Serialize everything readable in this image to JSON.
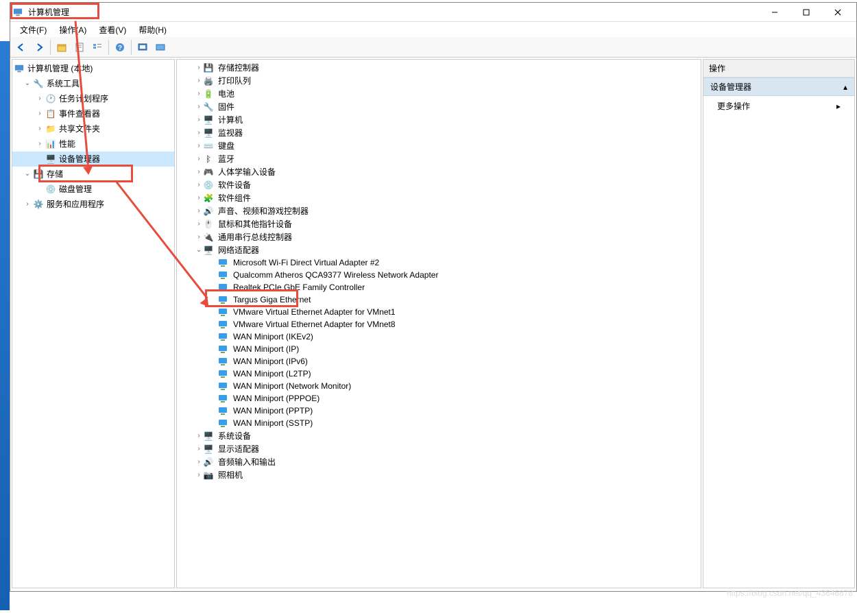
{
  "window": {
    "title": "计算机管理"
  },
  "menubar": {
    "file": "文件(F)",
    "action": "操作(A)",
    "view": "查看(V)",
    "help": "帮助(H)"
  },
  "leftTree": {
    "root": "计算机管理 (本地)",
    "systemTools": "系统工具",
    "taskScheduler": "任务计划程序",
    "eventViewer": "事件查看器",
    "sharedFolders": "共享文件夹",
    "performance": "性能",
    "deviceManager": "设备管理器",
    "storage": "存储",
    "diskManagement": "磁盘管理",
    "services": "服务和应用程序"
  },
  "deviceCategories": [
    "存储控制器",
    "打印队列",
    "电池",
    "固件",
    "计算机",
    "监视器",
    "键盘",
    "蓝牙",
    "人体学输入设备",
    "软件设备",
    "软件组件",
    "声音、视频和游戏控制器",
    "鼠标和其他指针设备",
    "通用串行总线控制器",
    "网络适配器"
  ],
  "networkAdapters": [
    "Microsoft Wi-Fi Direct Virtual Adapter #2",
    "Qualcomm Atheros QCA9377 Wireless Network Adapter",
    "Realtek PCIe GbE Family Controller",
    "Targus Giga Ethernet",
    "VMware Virtual Ethernet Adapter for VMnet1",
    "VMware Virtual Ethernet Adapter for VMnet8",
    "WAN Miniport (IKEv2)",
    "WAN Miniport (IP)",
    "WAN Miniport (IPv6)",
    "WAN Miniport (L2TP)",
    "WAN Miniport (Network Monitor)",
    "WAN Miniport (PPPOE)",
    "WAN Miniport (PPTP)",
    "WAN Miniport (SSTP)"
  ],
  "deviceCategoriesAfter": [
    "系统设备",
    "显示适配器",
    "音频输入和输出",
    "照相机"
  ],
  "rightPanel": {
    "header": "操作",
    "section": "设备管理器",
    "moreActions": "更多操作"
  },
  "watermark": "https://blog.csdn.net/qq_43646878"
}
